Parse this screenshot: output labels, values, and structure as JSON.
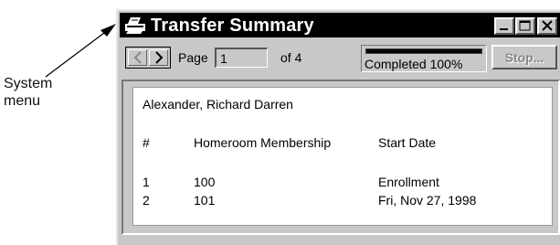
{
  "callout": {
    "line1": "System",
    "line2": "menu"
  },
  "window": {
    "title": "Transfer Summary"
  },
  "toolbar": {
    "page_label": "Page",
    "page_value": "1",
    "of_label": "of 4",
    "progress_percent": 100,
    "progress_text": "Completed 100%",
    "stop_label": "Stop..."
  },
  "report": {
    "student_name": "Alexander, Richard Darren",
    "columns": [
      "#",
      "Homeroom Membership",
      "Start Date"
    ],
    "rows": [
      {
        "num": "1",
        "homeroom": "100",
        "start": "Enrollment"
      },
      {
        "num": "2",
        "homeroom": "101",
        "start": "Fri, Nov 27, 1998"
      }
    ]
  }
}
